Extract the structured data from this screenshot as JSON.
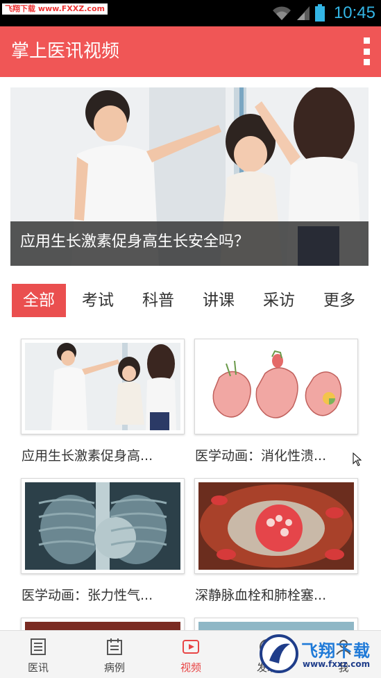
{
  "status_bar": {
    "watermark": "飞翔下载 www.FXXZ.com",
    "time": "10:45"
  },
  "app_bar": {
    "title": "掌上医讯视频",
    "menu_icon": "overflow-menu-icon"
  },
  "banner": {
    "caption": "应用生长激素促身高生长安全吗？"
  },
  "tabs": [
    {
      "label": "全部",
      "active": true
    },
    {
      "label": "考试",
      "active": false
    },
    {
      "label": "科普",
      "active": false
    },
    {
      "label": "讲课",
      "active": false
    },
    {
      "label": "采访",
      "active": false
    },
    {
      "label": "更多",
      "active": false
    }
  ],
  "videos": [
    {
      "title": "应用生长激素促身高..."
    },
    {
      "title": "医学动画：消化性溃..."
    },
    {
      "title": "医学动画：张力性气..."
    },
    {
      "title": "深静脉血栓和肺栓塞..."
    }
  ],
  "bottom_nav": [
    {
      "label": "医讯",
      "icon": "document-icon",
      "active": false
    },
    {
      "label": "病例",
      "icon": "calendar-list-icon",
      "active": false
    },
    {
      "label": "视频",
      "icon": "play-icon",
      "active": true
    },
    {
      "label": "发现",
      "icon": "compass-icon",
      "active": false
    },
    {
      "label": "我",
      "icon": "user-icon",
      "active": false
    }
  ],
  "overlay_logo": {
    "name": "飞翔下载",
    "url": "www.fxxz.com"
  },
  "colors": {
    "accent": "#f05656",
    "tab_active": "#ea4f4f",
    "nav_active": "#e84545",
    "status_time": "#33b5e5"
  }
}
